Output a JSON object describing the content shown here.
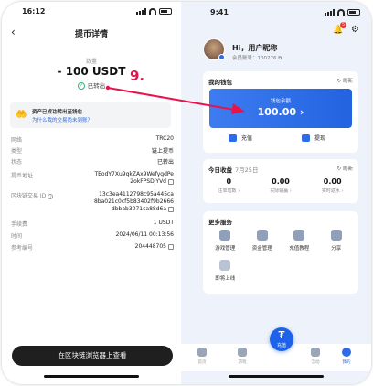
{
  "left": {
    "status": {
      "time": "16:12"
    },
    "nav": {
      "back": "‹",
      "title": "提币详情"
    },
    "amount_label": "数量",
    "amount": "- 100 USDT",
    "status_text": "已转出",
    "banner": {
      "line1": "资产已成功转出至钱包",
      "line2": "为什么我的交易尚未到账？"
    },
    "rows": [
      {
        "key": "网络",
        "value": "TRC20"
      },
      {
        "key": "类型",
        "value": "链上提币"
      },
      {
        "key": "状态",
        "value": "已转出"
      },
      {
        "key": "提币地址",
        "value": "TEodY7Xu9qkZAx9WefygdPe\n2okFPSDjYVd"
      },
      {
        "key": "区块链交易 ID",
        "value": "13c3ea4112798c95a445ca\n8ba021c0cf5b83402f9b2666\ndbbab3071ca88d6a"
      },
      {
        "key": "手续费",
        "value": "1 USDT"
      },
      {
        "key": "时间",
        "value": "2024/06/11 00:13:56"
      },
      {
        "key": "参考编号",
        "value": "204448705"
      }
    ],
    "button": "在区块链浏览器上查看"
  },
  "right": {
    "status": {
      "time": "9:41"
    },
    "badge": "5",
    "greeting": "Hi，用户昵称",
    "member_no": "会员账号：100276",
    "wallet": {
      "title": "我的钱包",
      "refresh": "刷新",
      "balance_label": "钱包余额",
      "balance": "100.00",
      "deposit": "充值",
      "withdraw": "提现"
    },
    "today": {
      "title": "今日收益",
      "date": "7月25日",
      "refresh": "刷新",
      "stats": [
        {
          "value": "0",
          "label": "注单笔数"
        },
        {
          "value": "0.00",
          "label": "实际输赢"
        },
        {
          "value": "0.00",
          "label": "实时返水"
        }
      ]
    },
    "services": {
      "title": "更多服务",
      "items": [
        {
          "label": "游戏管理",
          "icon": "gamepad-icon"
        },
        {
          "label": "资金管理",
          "icon": "coins-icon"
        },
        {
          "label": "充值教程",
          "icon": "tutorial-icon"
        },
        {
          "label": "分享",
          "icon": "share-icon"
        },
        {
          "label": "即将上线",
          "icon": "lightbulb-icon"
        }
      ]
    },
    "tabs": [
      {
        "label": "首页"
      },
      {
        "label": "游戏"
      },
      {
        "label": "充值"
      },
      {
        "label": "活动"
      },
      {
        "label": "我的"
      }
    ]
  },
  "annotation": {
    "step": "9."
  },
  "colors": {
    "accent": "#2f6ae8",
    "annotation": "#e8134b",
    "success": "#2bb673"
  }
}
